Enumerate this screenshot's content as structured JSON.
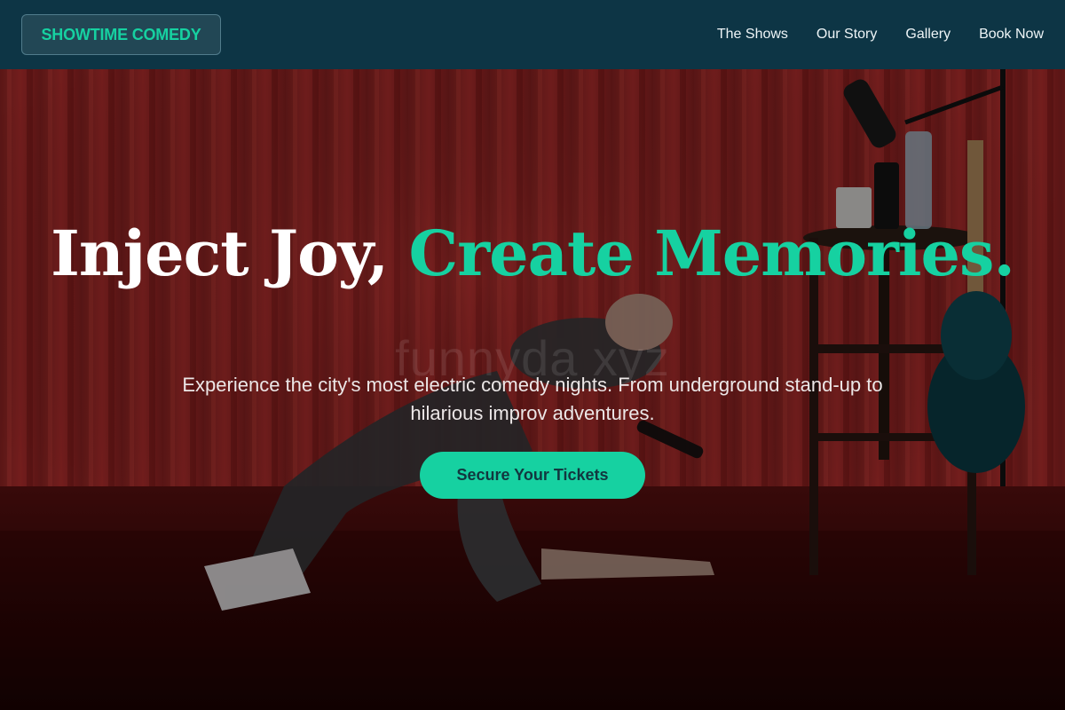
{
  "header": {
    "brand": "SHOWTIME COMEDY",
    "nav": [
      {
        "label": "The Shows"
      },
      {
        "label": "Our Story"
      },
      {
        "label": "Gallery"
      },
      {
        "label": "Book Now"
      }
    ]
  },
  "hero": {
    "headline_part1": "Inject Joy, ",
    "headline_part2": "Create Memories.",
    "subtitle": "Experience the city's most electric comedy nights. From underground stand-up to hilarious improv adventures.",
    "cta_label": "Secure Your Tickets",
    "watermark": "funnyda    xyz"
  },
  "colors": {
    "header_bg": "#0d3545",
    "accent": "#16d1a1",
    "curtain": "#b3302f",
    "text_light": "#ffffff"
  },
  "icons": {
    "scene": "comedian-on-stage-photo"
  }
}
